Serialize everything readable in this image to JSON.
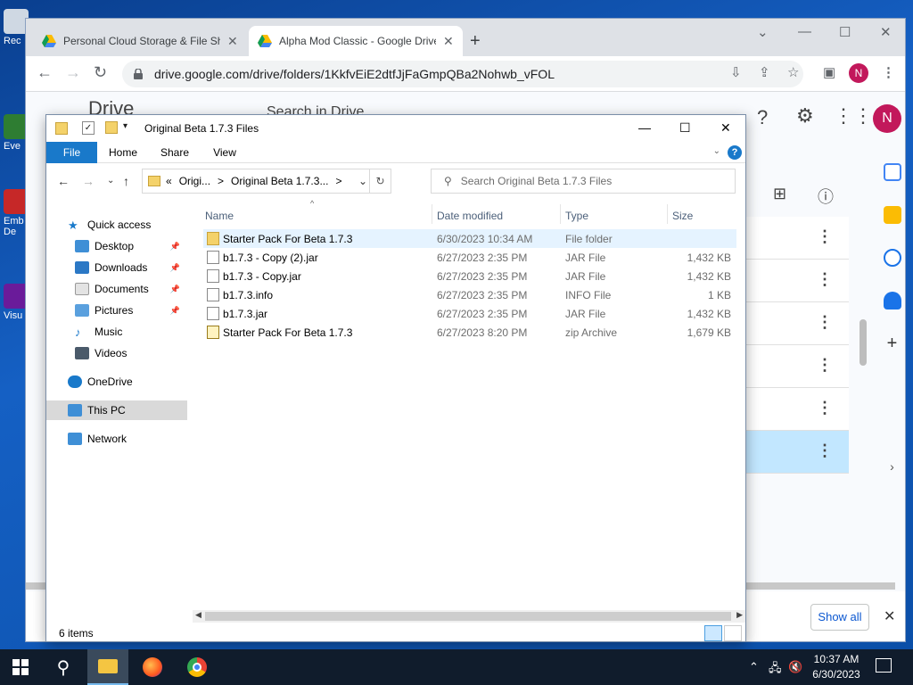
{
  "desktop": {
    "icons": [
      {
        "label": "Rec"
      },
      {
        "label": "Eve"
      },
      {
        "label": "Emb De"
      },
      {
        "label": "Visu"
      }
    ]
  },
  "chrome": {
    "tabs": [
      {
        "label": "Personal Cloud Storage & File Sh",
        "close": "✕"
      },
      {
        "label": "Alpha Mod Classic - Google Drive",
        "close": "✕"
      }
    ],
    "new_tab": "+",
    "url": "drive.google.com/drive/folders/1KkfvEiE2dtfJjFaGmpQBa2Nohwb_vFOL",
    "profile_initial": "N",
    "drive": {
      "logo_text": "Drive",
      "search_placeholder": "Search in Drive",
      "profile_initial": "N",
      "show_all": "Show all"
    }
  },
  "explorer": {
    "title": "Original Beta 1.7.3 Files",
    "ribbon_tabs": [
      "File",
      "Home",
      "Share",
      "View"
    ],
    "breadcrumb": [
      "«",
      "Origi...",
      ">",
      "Original Beta 1.7.3...",
      ">"
    ],
    "search_placeholder": "Search Original Beta 1.7.3 Files",
    "nav": {
      "quick_access": "Quick access",
      "items": [
        "Desktop",
        "Downloads",
        "Documents",
        "Pictures",
        "Music",
        "Videos"
      ],
      "onedrive": "OneDrive",
      "this_pc": "This PC",
      "network": "Network"
    },
    "columns": [
      "Name",
      "Date modified",
      "Type",
      "Size"
    ],
    "files": [
      {
        "name": "Starter Pack For Beta 1.7.3",
        "date": "6/30/2023 10:34 AM",
        "type": "File folder",
        "size": ""
      },
      {
        "name": "b1.7.3 - Copy (2).jar",
        "date": "6/27/2023 2:35 PM",
        "type": "JAR File",
        "size": "1,432 KB"
      },
      {
        "name": "b1.7.3 - Copy.jar",
        "date": "6/27/2023 2:35 PM",
        "type": "JAR File",
        "size": "1,432 KB"
      },
      {
        "name": "b1.7.3.info",
        "date": "6/27/2023 2:35 PM",
        "type": "INFO File",
        "size": "1 KB"
      },
      {
        "name": "b1.7.3.jar",
        "date": "6/27/2023 2:35 PM",
        "type": "JAR File",
        "size": "1,432 KB"
      },
      {
        "name": "Starter Pack For Beta 1.7.3",
        "date": "6/27/2023 8:20 PM",
        "type": "zip Archive",
        "size": "1,679 KB"
      }
    ],
    "status": "6 items"
  },
  "taskbar": {
    "time": "10:37 AM",
    "date": "6/30/2023"
  },
  "colors": {
    "file_tab": "#1979ca",
    "drive_selected": "#c2e7ff",
    "profile": "#c2185b",
    "taskbar": "#101c2c"
  }
}
